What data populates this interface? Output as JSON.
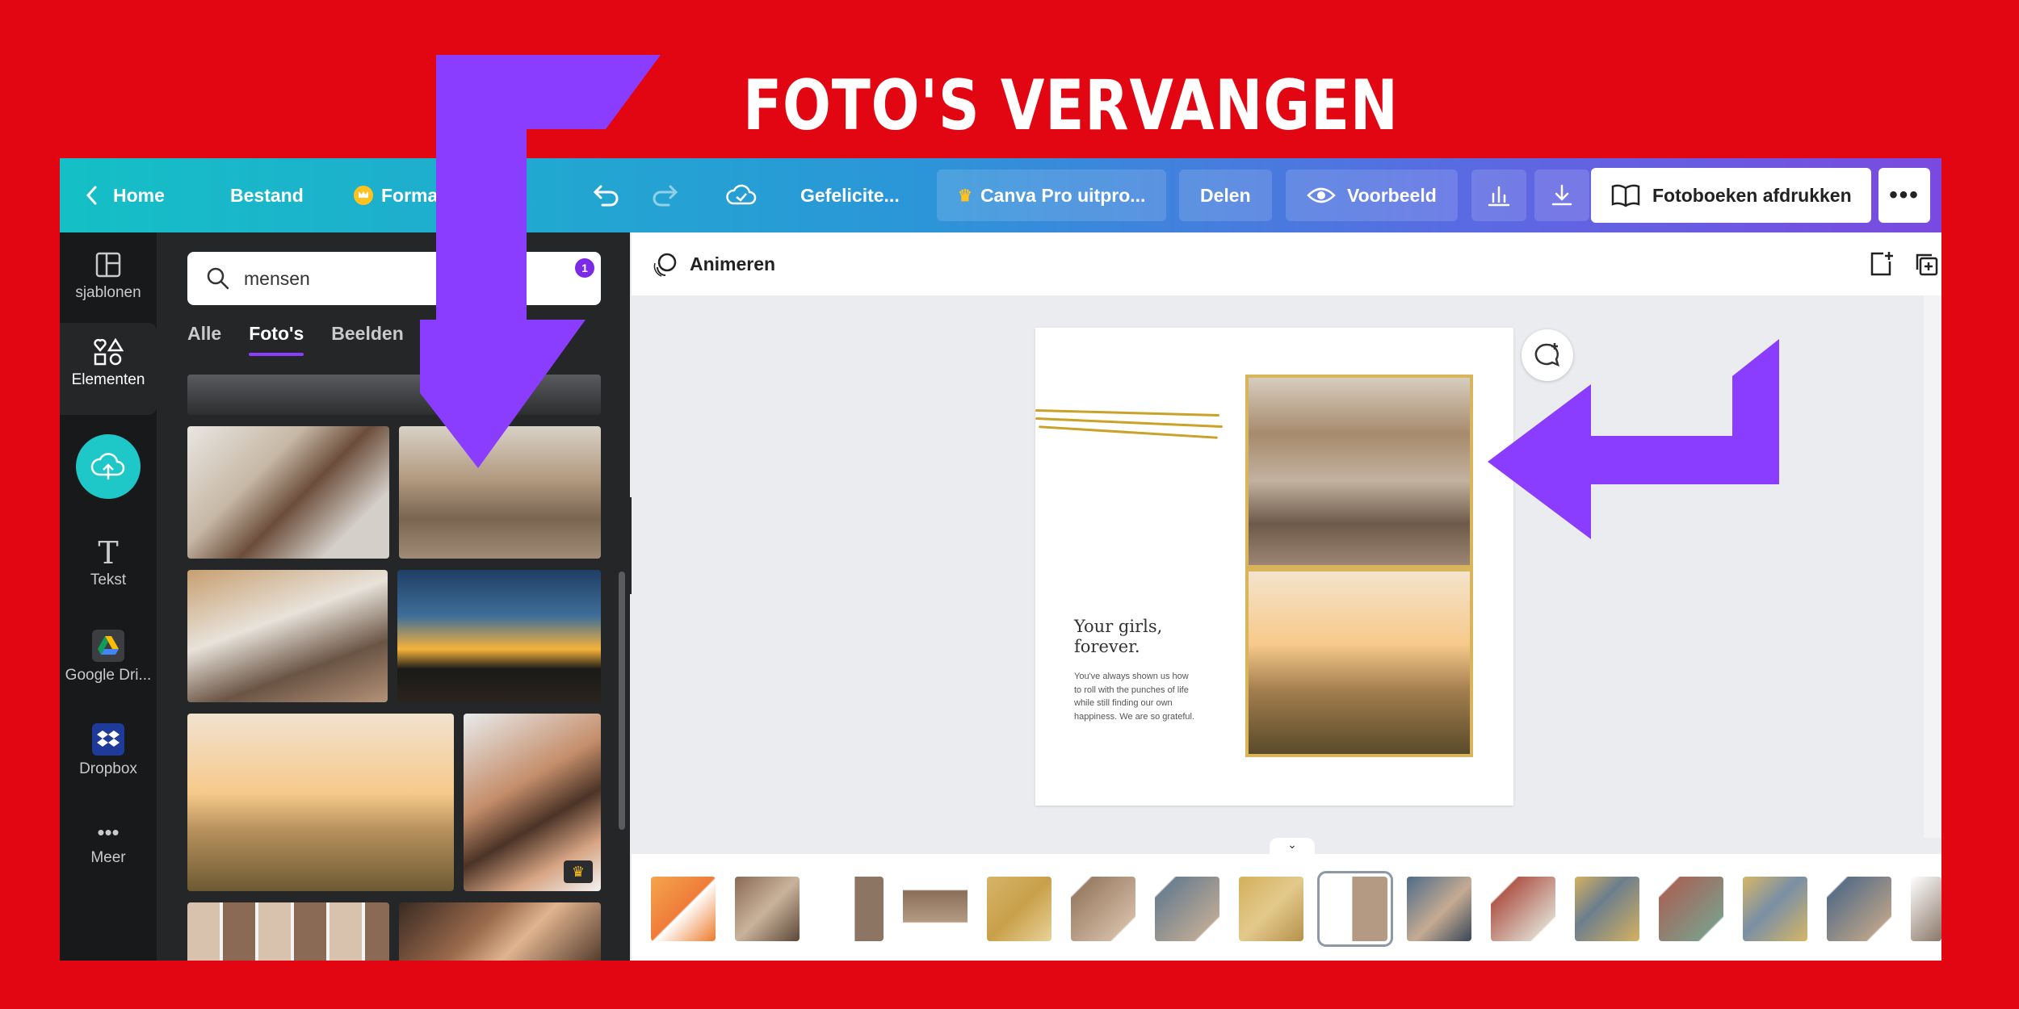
{
  "headline": "FOTO'S VERVANGEN",
  "topbar": {
    "home": "Home",
    "file": "Bestand",
    "resize": "Formaat wijzi",
    "title": "Gefelicite...",
    "pro": "Canva Pro uitpro...",
    "share": "Delen",
    "preview": "Voorbeeld",
    "print": "Fotoboeken afdrukken"
  },
  "rail": {
    "templates": "sjablonen",
    "elements": "Elementen",
    "text": "Tekst",
    "drive": "Google Dri...",
    "dropbox": "Dropbox",
    "more": "Meer"
  },
  "panel": {
    "search_value": "mensen",
    "filter_count": "1",
    "tabs": [
      "Alle",
      "Foto's",
      "Beelden"
    ],
    "active_tab": "Foto's"
  },
  "editor": {
    "animate": "Animeren"
  },
  "page": {
    "title": "Your girls,\nforever.",
    "body": "You've always shown us how\nto roll with the punches of life\nwhile still finding our own\nhappiness. We are so grateful."
  },
  "colors": {
    "background": "#e20613",
    "accent": "#8b3dff",
    "arrow": "#8b3dff",
    "upload": "#1fc8c8"
  }
}
